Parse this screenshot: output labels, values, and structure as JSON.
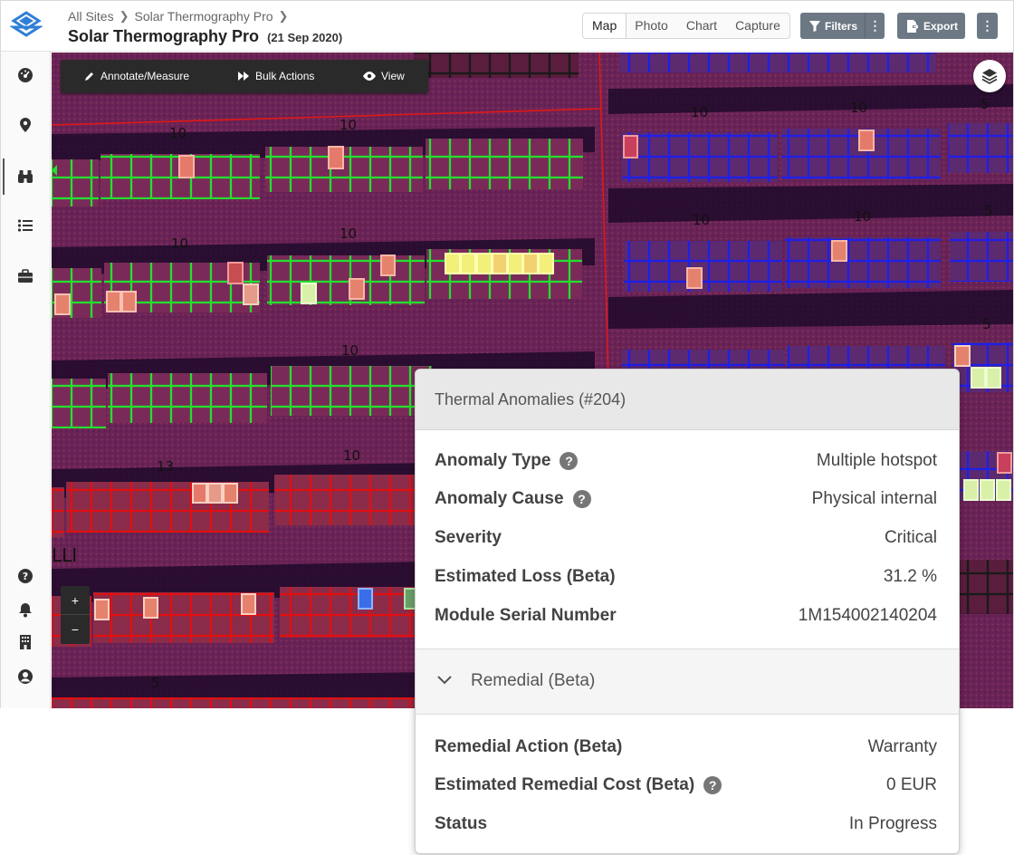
{
  "breadcrumb": {
    "root": "All Sites",
    "site": "Solar Thermography Pro"
  },
  "page": {
    "title": "Solar Thermography Pro",
    "date": "(21 Sep 2020)"
  },
  "view_tabs": [
    {
      "label": "Map",
      "active": true
    },
    {
      "label": "Photo",
      "active": false
    },
    {
      "label": "Chart",
      "active": false
    },
    {
      "label": "Capture",
      "active": false
    }
  ],
  "actions": {
    "filters": "Filters",
    "export": "Export"
  },
  "sidebar": {
    "icons": [
      "dashboard-icon",
      "location-pin-icon",
      "binoculars-icon",
      "list-icon",
      "briefcase-icon",
      "help-icon",
      "bell-icon",
      "building-icon",
      "user-icon"
    ],
    "active": "binoculars-icon"
  },
  "map_toolbar": {
    "annotate": "Annotate/Measure",
    "bulk": "Bulk Actions",
    "view": "View"
  },
  "zoom": {
    "in": "+",
    "out": "−"
  },
  "map_labels": {
    "ten": "10",
    "thirteen": "13",
    "five": "5",
    "llt": "LLI"
  },
  "colors": {
    "accent": "#2f7fd6",
    "sidebar_bg": "#fafafa",
    "button": "#6c7884",
    "green_outline": "#2ee83a",
    "blue_outline": "#1d1ff0",
    "red_outline": "#ee1010"
  },
  "card": {
    "title": "Thermal Anomalies (#204)",
    "details": [
      {
        "label": "Anomaly Type",
        "value": "Multiple hotspot",
        "help": true
      },
      {
        "label": "Anomaly Cause",
        "value": "Physical internal",
        "help": true
      },
      {
        "label": "Severity",
        "value": "Critical",
        "help": false
      },
      {
        "label": "Estimated Loss (Beta)",
        "value": "31.2 %",
        "help": false
      },
      {
        "label": "Module Serial Number",
        "value": "1M154002140204",
        "help": false
      }
    ],
    "remedial_title": "Remedial (Beta)",
    "remedial": [
      {
        "label": "Remedial Action (Beta)",
        "value": "Warranty",
        "help": false
      },
      {
        "label": "Estimated Remedial Cost (Beta)",
        "value": "0 EUR",
        "help": true
      },
      {
        "label": "Status",
        "value": "In Progress",
        "help": false
      }
    ]
  }
}
